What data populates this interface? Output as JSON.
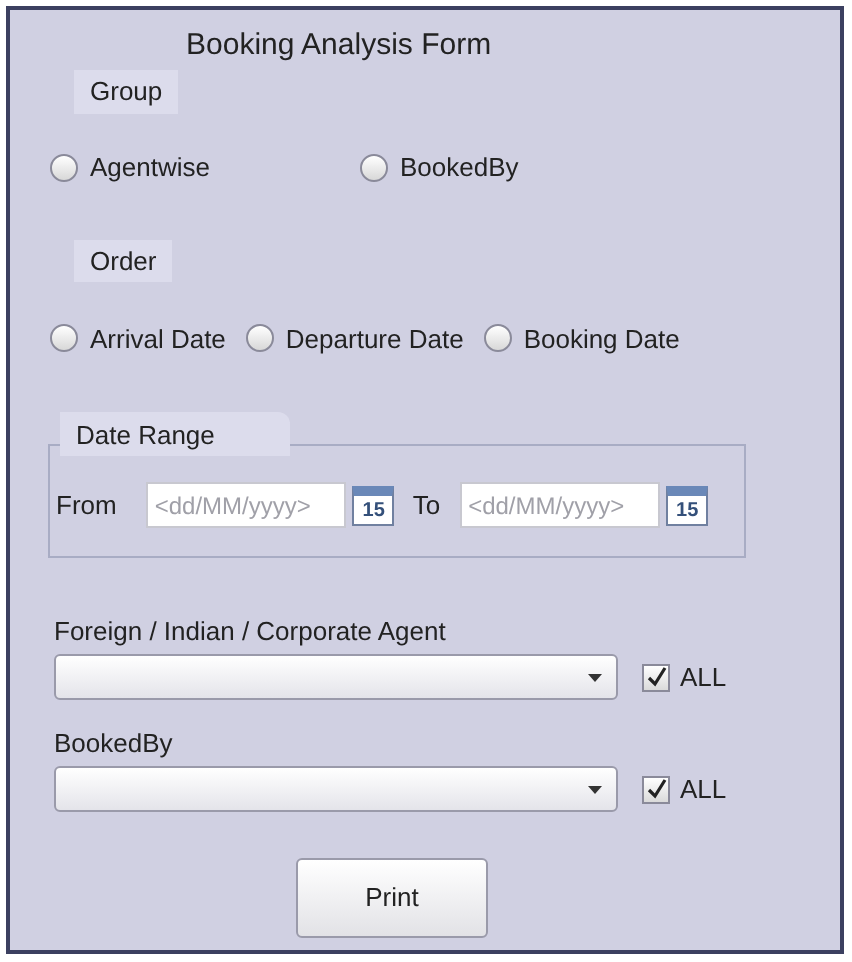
{
  "title": "Booking Analysis Form",
  "group": {
    "label": "Group",
    "options": [
      {
        "label": "Agentwise",
        "selected": false
      },
      {
        "label": "BookedBy",
        "selected": false
      }
    ]
  },
  "order": {
    "label": "Order",
    "options": [
      {
        "label": "Arrival Date",
        "selected": false
      },
      {
        "label": "Departure Date",
        "selected": false
      },
      {
        "label": "Booking Date",
        "selected": false
      }
    ]
  },
  "date_range": {
    "label": "Date Range",
    "fields": [
      {
        "label": "From",
        "placeholder": "<dd/MM/yyyy>",
        "calendar_day": "15"
      },
      {
        "label": "To",
        "placeholder": "<dd/MM/yyyy>",
        "calendar_day": "15"
      }
    ]
  },
  "dropdowns": [
    {
      "label": "Foreign / Indian / Corporate Agent",
      "all_label": "ALL",
      "checked": true
    },
    {
      "label": "BookedBy",
      "all_label": "ALL",
      "checked": true
    }
  ],
  "print_button": "Print"
}
